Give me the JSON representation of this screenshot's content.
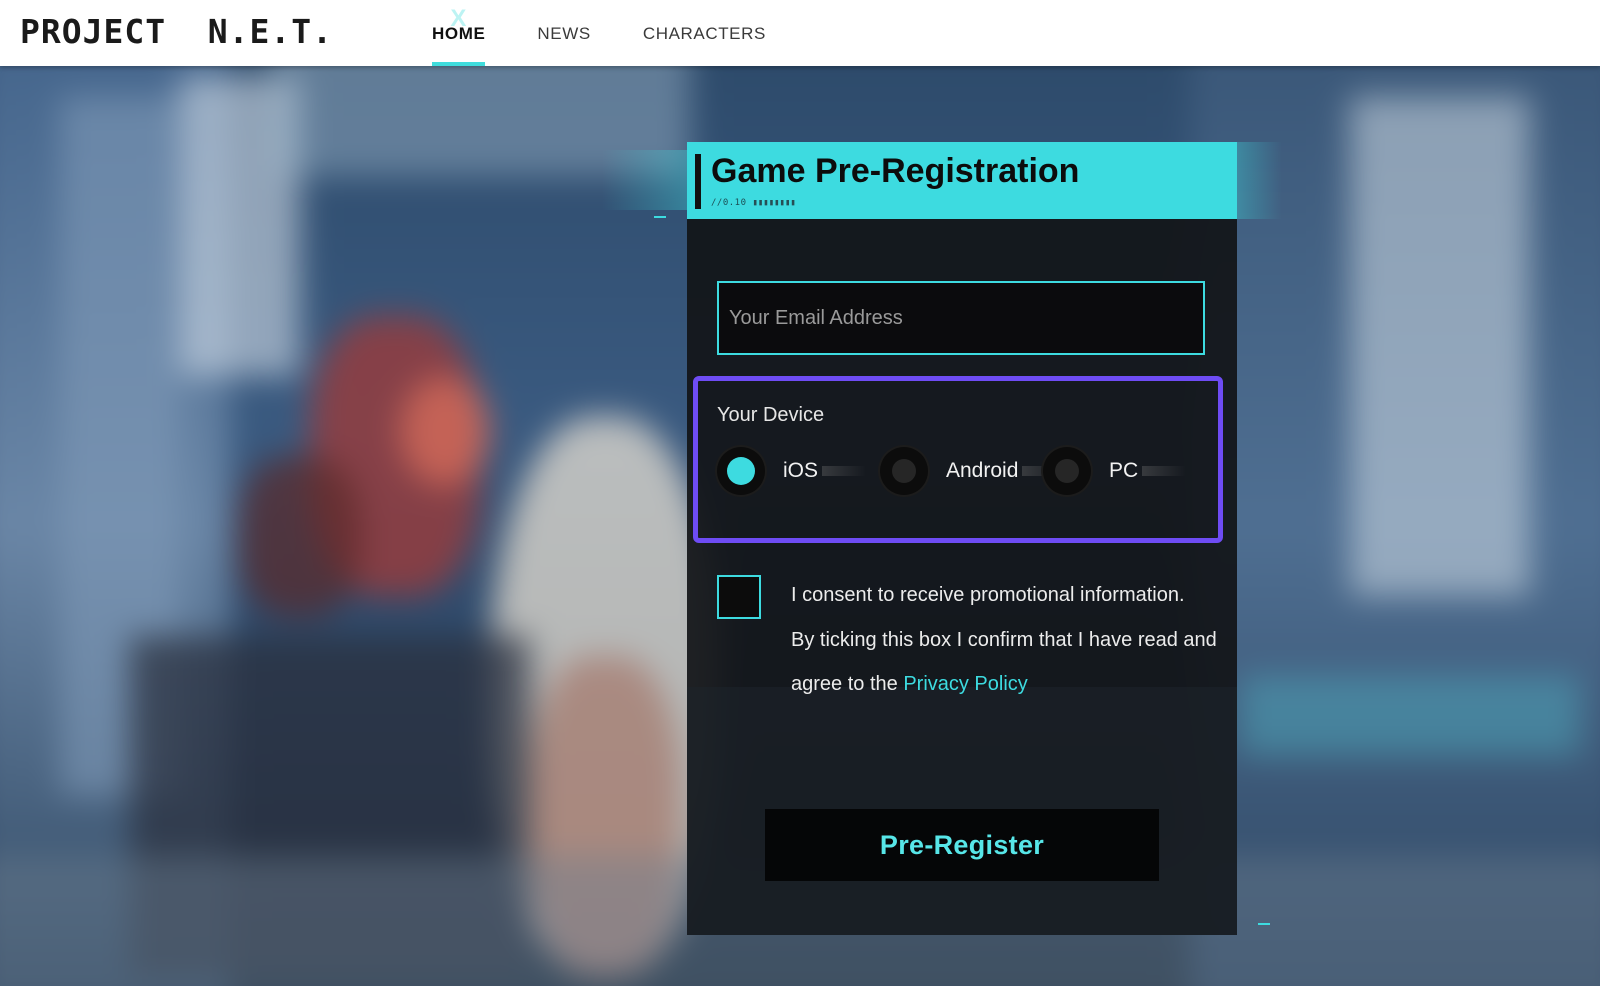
{
  "site": {
    "logo": "PROJECT  N.E.T."
  },
  "nav": {
    "items": [
      {
        "label": "HOME",
        "active": true
      },
      {
        "label": "NEWS",
        "active": false
      },
      {
        "label": "CHARACTERS",
        "active": false
      }
    ]
  },
  "form": {
    "title": "Game Pre-Registration",
    "version": "//0.10",
    "email": {
      "placeholder": "Your Email Address",
      "value": ""
    },
    "device": {
      "label": "Your Device",
      "options": [
        {
          "label": "iOS",
          "selected": true
        },
        {
          "label": "Android",
          "selected": false
        },
        {
          "label": "PC",
          "selected": false
        }
      ],
      "highlight_color": "#6e4cf4"
    },
    "consent": {
      "checked": false,
      "line1": "I consent to receive promotional information.",
      "line2_prefix": "By ticking this box I confirm that I have read and agree to the ",
      "link_text": "Privacy Policy"
    },
    "submit_label": "Pre-Register"
  },
  "colors": {
    "accent": "#3ddbe0",
    "header_bg": "#ffffff"
  }
}
